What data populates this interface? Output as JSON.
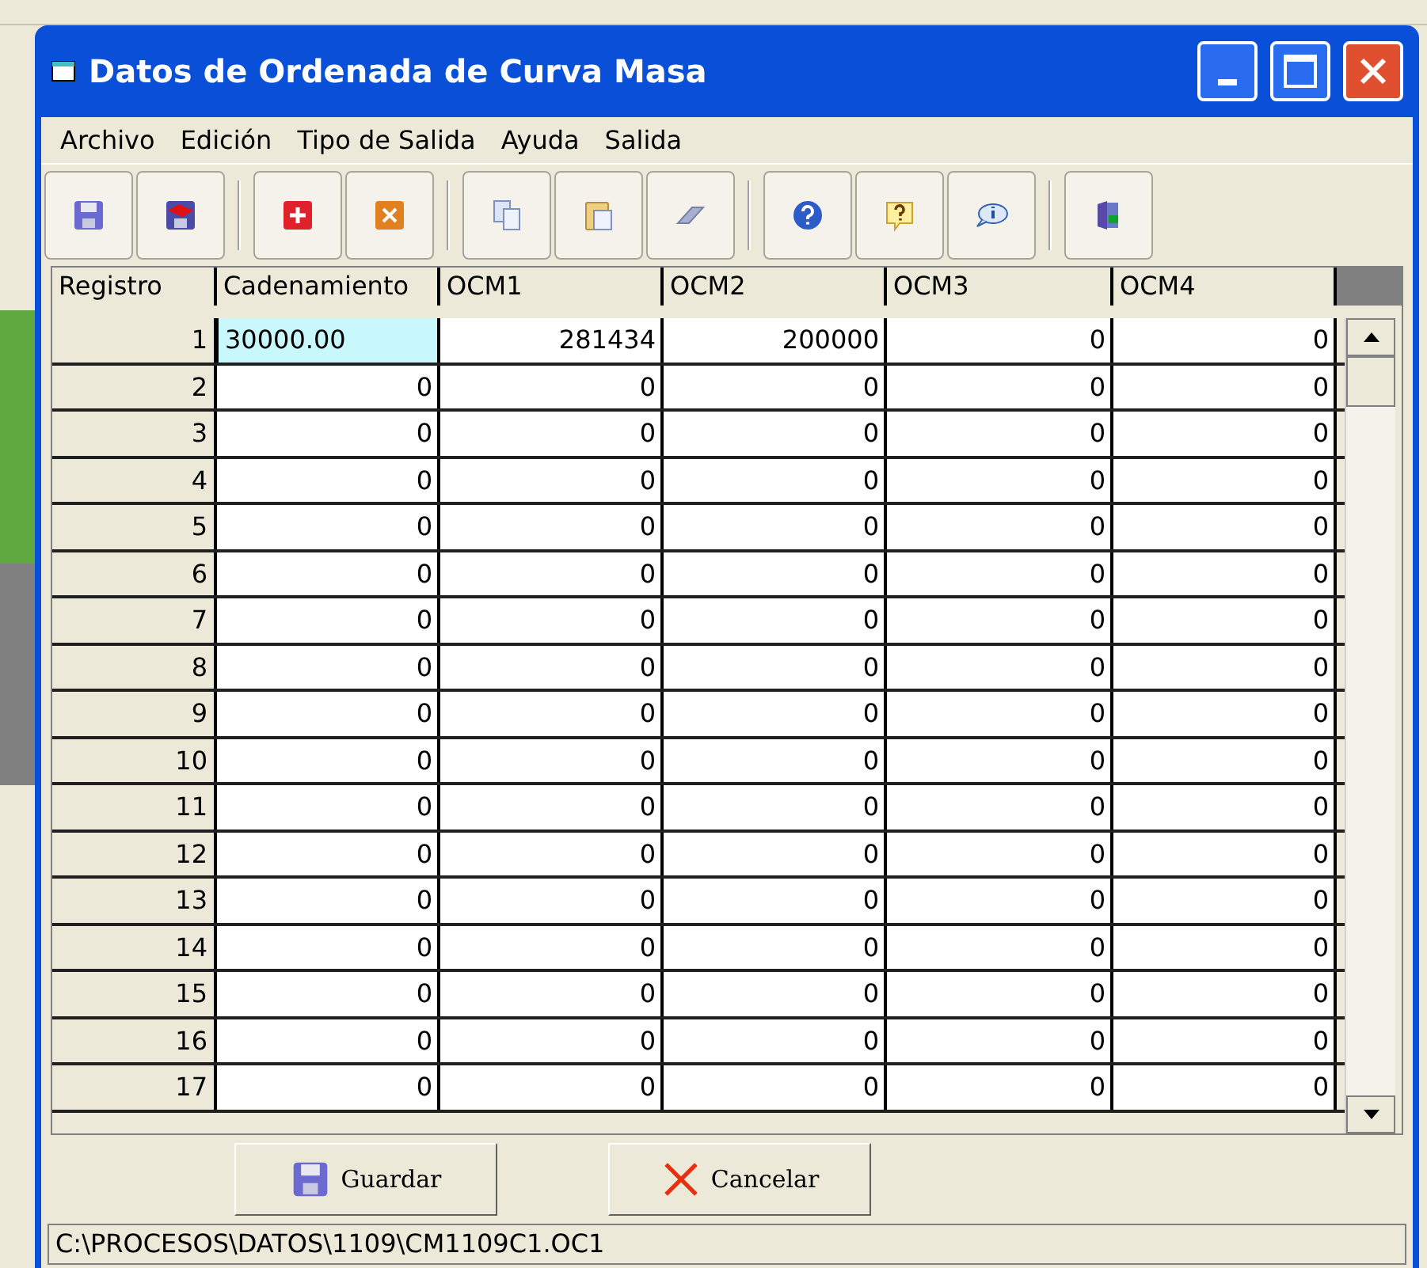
{
  "window": {
    "title": "Datos de Ordenada de Curva Masa"
  },
  "menu": [
    "Archivo",
    "Edición",
    "Tipo de Salida",
    "Ayuda",
    "Salida"
  ],
  "toolbar": [
    [
      {
        "kind": "save"
      },
      {
        "kind": "save-as"
      }
    ],
    [
      {
        "kind": "add"
      },
      {
        "kind": "delete"
      }
    ],
    [
      {
        "kind": "copy"
      },
      {
        "kind": "paste"
      },
      {
        "kind": "erase"
      }
    ],
    [
      {
        "kind": "help"
      },
      {
        "kind": "question"
      },
      {
        "kind": "info"
      }
    ],
    [
      {
        "kind": "exit"
      }
    ]
  ],
  "table": {
    "columns": [
      "Registro",
      "Cadenamiento",
      "OCM1",
      "OCM2",
      "OCM3",
      "OCM4"
    ],
    "rows": [
      {
        "registro": "1",
        "values": [
          "30000.00",
          "281434",
          "200000",
          "0",
          "0"
        ],
        "editing": true
      },
      {
        "registro": "2",
        "values": [
          "0",
          "0",
          "0",
          "0",
          "0"
        ],
        "editing": false
      },
      {
        "registro": "3",
        "values": [
          "0",
          "0",
          "0",
          "0",
          "0"
        ],
        "editing": false
      },
      {
        "registro": "4",
        "values": [
          "0",
          "0",
          "0",
          "0",
          "0"
        ],
        "editing": false
      },
      {
        "registro": "5",
        "values": [
          "0",
          "0",
          "0",
          "0",
          "0"
        ],
        "editing": false
      },
      {
        "registro": "6",
        "values": [
          "0",
          "0",
          "0",
          "0",
          "0"
        ],
        "editing": false
      },
      {
        "registro": "7",
        "values": [
          "0",
          "0",
          "0",
          "0",
          "0"
        ],
        "editing": false
      },
      {
        "registro": "8",
        "values": [
          "0",
          "0",
          "0",
          "0",
          "0"
        ],
        "editing": false
      },
      {
        "registro": "9",
        "values": [
          "0",
          "0",
          "0",
          "0",
          "0"
        ],
        "editing": false
      },
      {
        "registro": "10",
        "values": [
          "0",
          "0",
          "0",
          "0",
          "0"
        ],
        "editing": false
      },
      {
        "registro": "11",
        "values": [
          "0",
          "0",
          "0",
          "0",
          "0"
        ],
        "editing": false
      },
      {
        "registro": "12",
        "values": [
          "0",
          "0",
          "0",
          "0",
          "0"
        ],
        "editing": false
      },
      {
        "registro": "13",
        "values": [
          "0",
          "0",
          "0",
          "0",
          "0"
        ],
        "editing": false
      },
      {
        "registro": "14",
        "values": [
          "0",
          "0",
          "0",
          "0",
          "0"
        ],
        "editing": false
      },
      {
        "registro": "15",
        "values": [
          "0",
          "0",
          "0",
          "0",
          "0"
        ],
        "editing": false
      },
      {
        "registro": "16",
        "values": [
          "0",
          "0",
          "0",
          "0",
          "0"
        ],
        "editing": false
      },
      {
        "registro": "17",
        "values": [
          "0",
          "0",
          "0",
          "0",
          "0"
        ],
        "editing": false
      }
    ]
  },
  "buttons": [
    {
      "kind": "save",
      "label": "Guardar"
    },
    {
      "kind": "cancel",
      "label": "Cancelar"
    }
  ],
  "status_bar": "C:\\PROCESOS\\DATOS\\1109\\CM1109C1.OC1"
}
